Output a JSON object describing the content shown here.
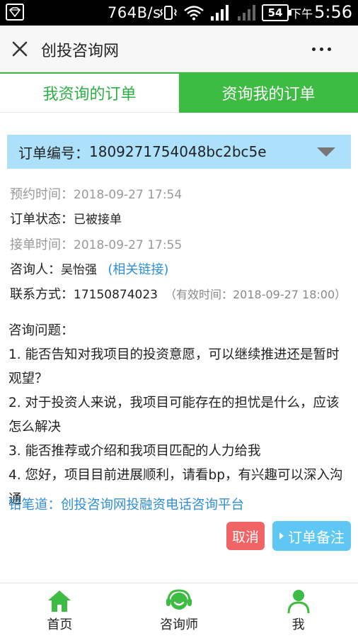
{
  "status_bar": {
    "speed": "764B/s",
    "battery": "54",
    "time_prefix": "下午",
    "time": "5:56"
  },
  "header": {
    "title": "创投咨询网"
  },
  "tabs": [
    {
      "label": "我资询的订单",
      "active": true
    },
    {
      "label": "资询我的订单",
      "active": false
    }
  ],
  "order": {
    "number_label": "订单编号：",
    "number": "1809271754048bc2bc5e",
    "reserve_label": "预约时间：",
    "reserve_time": "2018-09-27 17:54",
    "status_label": "订单状态：",
    "status": "已被接单",
    "accept_label": "接单时间：",
    "accept_time": "2018-09-27 17:55",
    "consultant_label": "咨询人：",
    "consultant": "吴怡强",
    "related_link": "(相关链接)",
    "contact_label": "联系方式：",
    "contact": "17150874023",
    "valid_text": "（有效时间：2018-09-27 18:00）"
  },
  "question": {
    "title": "咨询问题：",
    "items": [
      "1. 能否告知对我项目的投资意愿，可以继续推进还是暂时观望？",
      "2. 对于投资人来说，我项目可能存在的担忧是什么，应该怎么解决",
      "3. 能否推荐或介绍和我项目匹配的人力给我",
      "4. 您好，项目目前进展顺利，请看bp，有兴趣可以深入沟通"
    ],
    "platform": "铅笔道：创投咨询网投融资电话咨询平台"
  },
  "buttons": {
    "cancel": "取消",
    "note": "订单备注"
  },
  "bottom_nav": [
    {
      "label": "首页",
      "icon": "home-icon"
    },
    {
      "label": "咨询师",
      "icon": "headset-icon"
    },
    {
      "label": "我",
      "icon": "user-icon"
    }
  ],
  "colors": {
    "green": "#3dbb43",
    "order_bar": "#ade1fb",
    "link": "#2e8fd6",
    "cancel": "#f06466",
    "note": "#5ec7f3"
  }
}
